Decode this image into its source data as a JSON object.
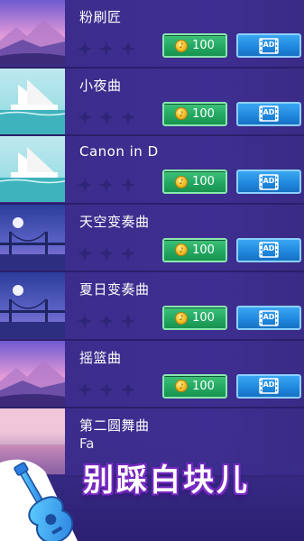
{
  "songs": [
    {
      "title": "粉刷匠",
      "price": "100",
      "thumb": "sunset"
    },
    {
      "title": "小夜曲",
      "price": "100",
      "thumb": "sailboat"
    },
    {
      "title": "Canon in D",
      "price": "100",
      "thumb": "sailboat"
    },
    {
      "title": "天空变奏曲",
      "price": "100",
      "thumb": "bridge"
    },
    {
      "title": "夏日变奏曲",
      "price": "100",
      "thumb": "bridge"
    },
    {
      "title": "摇篮曲",
      "price": "100",
      "thumb": "sunset"
    },
    {
      "title": "第二圆舞曲",
      "thumb": "pink"
    }
  ],
  "ad_label": "AD",
  "banner": {
    "text": "别踩白块儿",
    "partial_title": "Fa"
  },
  "colors": {
    "coin_button": "#23a862",
    "ad_button": "#1f86dd",
    "row_bg": "#3b2c8b",
    "banner_text_outline": "#7a2bc7"
  }
}
